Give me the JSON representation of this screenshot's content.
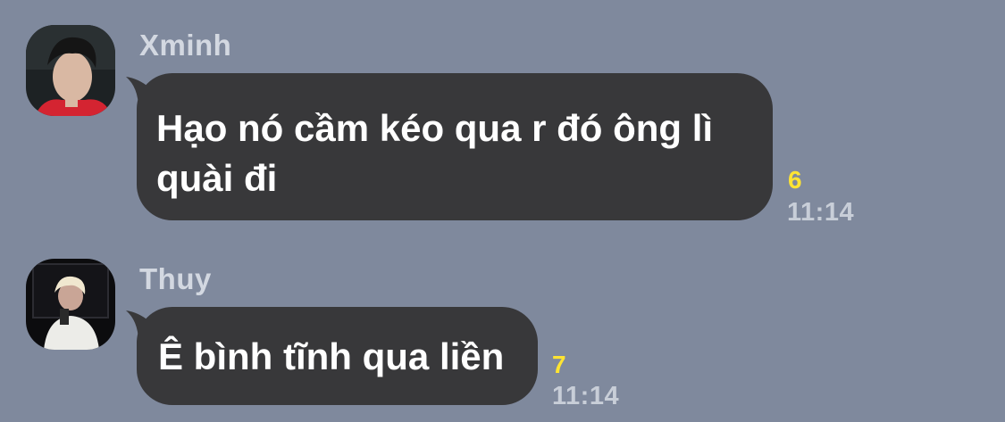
{
  "messages": [
    {
      "sender": "Xminh",
      "avatar_icon": "avatar-red-shirt-icon",
      "text_line1": "Hạo nó cầm kéo qua r đó ông lì",
      "text_line2": "quài đi",
      "read_count": "6",
      "time": "11:14"
    },
    {
      "sender": "Thuy",
      "avatar_icon": "avatar-white-suit-icon",
      "text_line1": "Ê bình tĩnh qua liền",
      "read_count": "7",
      "time": "11:14"
    }
  ],
  "colors": {
    "background": "#7f899d",
    "bubble": "#38383a",
    "read_count": "#ffe432",
    "time": "#c8ced8"
  }
}
